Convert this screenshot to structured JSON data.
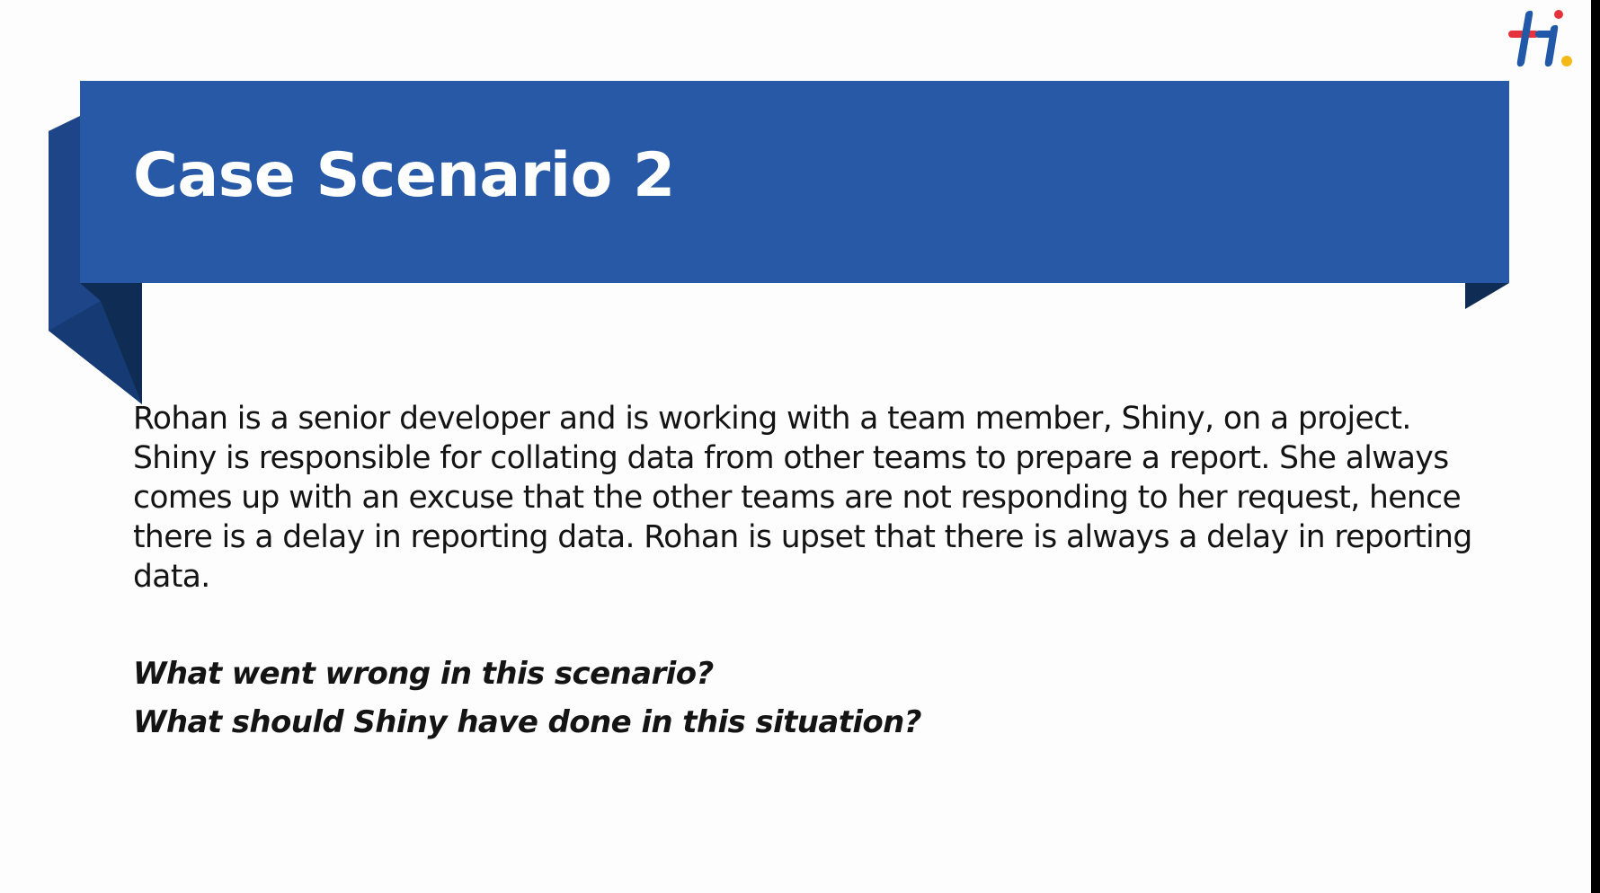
{
  "slide": {
    "title": "Case Scenario 2",
    "paragraph": "Rohan is a senior developer and is working with a team member, Shiny, on a project. Shiny is responsible for collating data from other teams to prepare a report. She always comes up with an excuse that the other teams are not responding to her request, hence there is a delay in reporting data. Rohan is upset that there is always a delay in reporting data.",
    "questions": [
      "What went wrong in this scenario?",
      "What should Shiny have done in this situation?"
    ]
  },
  "logo": {
    "icon": "hi-logo-icon",
    "colors": {
      "red": "#e5333b",
      "blue": "#2158a8",
      "yellow": "#f5b915"
    }
  },
  "colors": {
    "banner": "#2759a7",
    "banner_fold_dark": "#0f2c55",
    "banner_fold_mid": "#1d4588",
    "background": "#fdfdfd",
    "text": "#141414",
    "title_text": "#ffffff"
  }
}
